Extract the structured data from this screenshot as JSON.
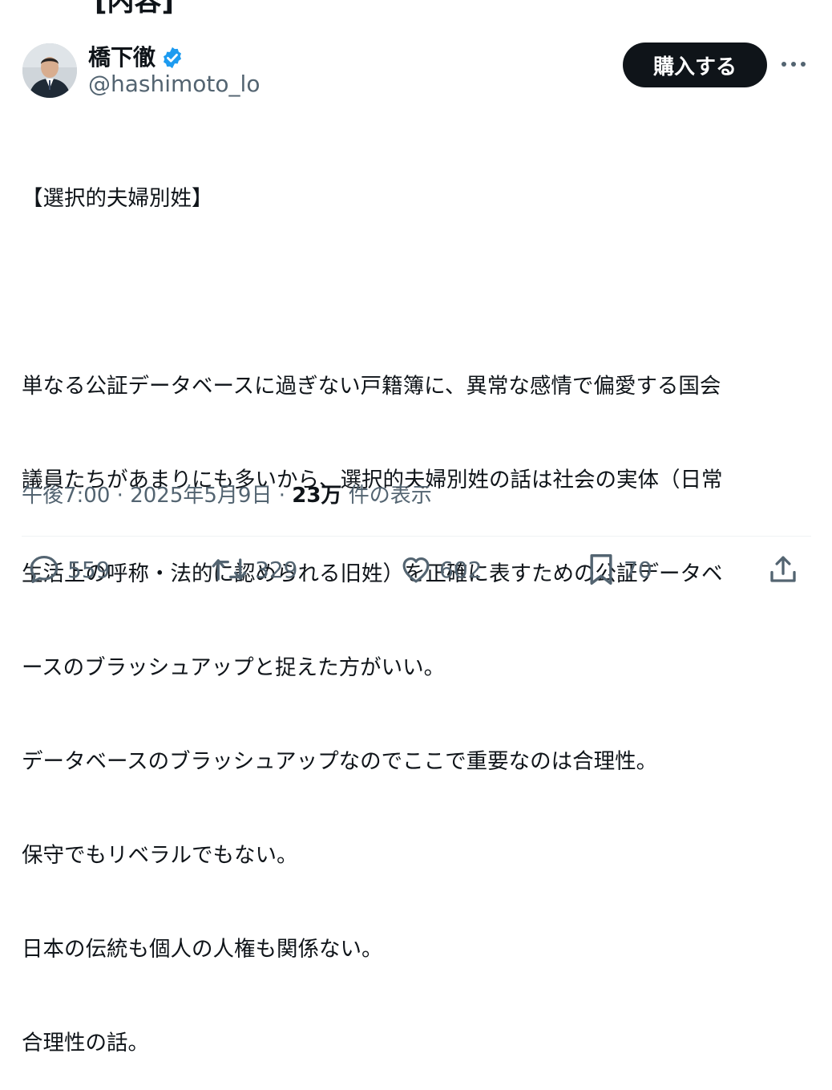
{
  "top_cut_text": "[内容]",
  "author": {
    "display_name": "橋下徹",
    "handle": "@hashimoto_lo",
    "verified": true
  },
  "buy_button_label": "購入する",
  "tweet": {
    "lines": [
      "【選択的夫婦別姓】",
      "",
      "単なる公証データベースに過ぎない戸籍簿に、異常な感情で偏愛する国会",
      "議員たちがあまりにも多いから、選択的夫婦別姓の話は社会の実体（日常",
      "生活上の呼称・法的に認められる旧姓）を正確に表すための公証データベ",
      "ースのブラッシュアップと捉えた方がいい。",
      "データベースのブラッシュアップなのでここで重要なのは合理性。",
      "保守でもリベラルでもない。",
      "日本の伝統も個人の人権も関係ない。",
      "合理性の話。"
    ]
  },
  "meta": {
    "time": "午後7:00",
    "sep1": " · ",
    "date": "2025年5月9日",
    "sep2": " · ",
    "views_count": "23万",
    "views_label": " 件の表示"
  },
  "actions": {
    "replies": "559",
    "retweets": "329",
    "likes": "602",
    "bookmarks": "70"
  },
  "colors": {
    "accent_verified": "#1d9bf0",
    "button_bg": "#0f1419",
    "muted_text": "#536471"
  }
}
